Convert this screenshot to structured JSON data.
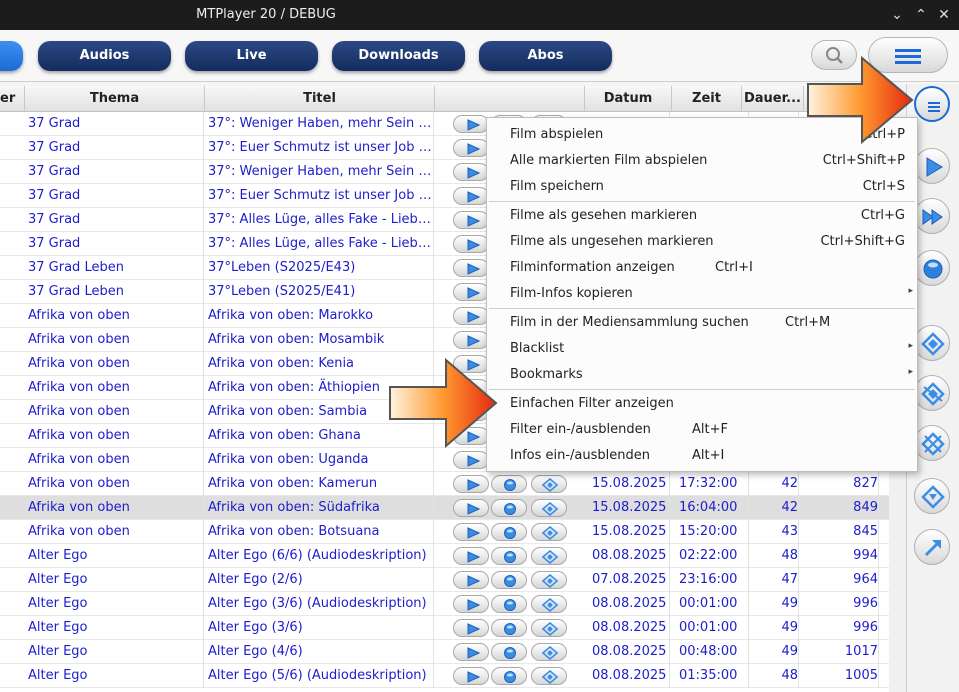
{
  "window": {
    "title": "MTPlayer 20 / DEBUG"
  },
  "toolbar": {
    "tabs": [
      "Audios",
      "Live",
      "Downloads",
      "Abos"
    ]
  },
  "table": {
    "headers": {
      "partial": "er",
      "thema": "Thema",
      "titel": "Titel",
      "datum": "Datum",
      "zeit": "Zeit",
      "dauer": "Dauer..."
    },
    "rows": [
      {
        "thema": "37 Grad",
        "titel": "37°: Weniger Haben, mehr Sein (S...",
        "datum": "",
        "zeit": "",
        "dauer": "",
        "size": ""
      },
      {
        "thema": "37 Grad",
        "titel": "37°: Euer Schmutz ist unser Job (S...",
        "datum": "",
        "zeit": "",
        "dauer": "",
        "size": ""
      },
      {
        "thema": "37 Grad",
        "titel": "37°: Weniger Haben, mehr Sein (S...",
        "datum": "",
        "zeit": "",
        "dauer": "",
        "size": ""
      },
      {
        "thema": "37 Grad",
        "titel": "37°: Euer Schmutz ist unser Job (S...",
        "datum": "",
        "zeit": "",
        "dauer": "",
        "size": ""
      },
      {
        "thema": "37 Grad",
        "titel": "37°: Alles Lüge, alles Fake - Liebes...",
        "datum": "",
        "zeit": "",
        "dauer": "",
        "size": ""
      },
      {
        "thema": "37 Grad",
        "titel": "37°: Alles Lüge, alles Fake - Liebes...",
        "datum": "",
        "zeit": "",
        "dauer": "",
        "size": ""
      },
      {
        "thema": "37 Grad Leben",
        "titel": "37°Leben (S2025/E43)",
        "datum": "",
        "zeit": "",
        "dauer": "",
        "size": ""
      },
      {
        "thema": "37 Grad Leben",
        "titel": "37°Leben (S2025/E41)",
        "datum": "",
        "zeit": "",
        "dauer": "",
        "size": ""
      },
      {
        "thema": "Afrika von oben",
        "titel": "Afrika von oben: Marokko",
        "datum": "",
        "zeit": "",
        "dauer": "",
        "size": ""
      },
      {
        "thema": "Afrika von oben",
        "titel": "Afrika von oben: Mosambik",
        "datum": "",
        "zeit": "",
        "dauer": "",
        "size": ""
      },
      {
        "thema": "Afrika von oben",
        "titel": "Afrika von oben: Kenia",
        "datum": "",
        "zeit": "",
        "dauer": "",
        "size": ""
      },
      {
        "thema": "Afrika von oben",
        "titel": "Afrika von oben: Äthiopien",
        "datum": "",
        "zeit": "",
        "dauer": "",
        "size": ""
      },
      {
        "thema": "Afrika von oben",
        "titel": "Afrika von oben: Sambia",
        "datum": "",
        "zeit": "",
        "dauer": "",
        "size": ""
      },
      {
        "thema": "Afrika von oben",
        "titel": "Afrika von oben: Ghana",
        "datum": "",
        "zeit": "",
        "dauer": "",
        "size": ""
      },
      {
        "thema": "Afrika von oben",
        "titel": "Afrika von oben: Uganda",
        "datum": "",
        "zeit": "",
        "dauer": "",
        "size": ""
      },
      {
        "thema": "Afrika von oben",
        "titel": "Afrika von oben: Kamerun",
        "datum": "15.08.2025",
        "zeit": "17:32:00",
        "dauer": "42",
        "size": "827"
      },
      {
        "thema": "Afrika von oben",
        "titel": "Afrika von oben: Südafrika",
        "datum": "15.08.2025",
        "zeit": "16:04:00",
        "dauer": "42",
        "size": "849"
      },
      {
        "thema": "Afrika von oben",
        "titel": "Afrika von oben: Botsuana",
        "datum": "15.08.2025",
        "zeit": "15:20:00",
        "dauer": "43",
        "size": "845"
      },
      {
        "thema": "Alter Ego",
        "titel": "Alter Ego (6/6) (Audiodeskription)",
        "datum": "08.08.2025",
        "zeit": "02:22:00",
        "dauer": "48",
        "size": "994"
      },
      {
        "thema": "Alter Ego",
        "titel": "Alter Ego (2/6)",
        "datum": "07.08.2025",
        "zeit": "23:16:00",
        "dauer": "47",
        "size": "964"
      },
      {
        "thema": "Alter Ego",
        "titel": "Alter Ego (3/6) (Audiodeskription)",
        "datum": "08.08.2025",
        "zeit": "00:01:00",
        "dauer": "49",
        "size": "996"
      },
      {
        "thema": "Alter Ego",
        "titel": "Alter Ego (3/6)",
        "datum": "08.08.2025",
        "zeit": "00:01:00",
        "dauer": "49",
        "size": "996"
      },
      {
        "thema": "Alter Ego",
        "titel": "Alter Ego (4/6)",
        "datum": "08.08.2025",
        "zeit": "00:48:00",
        "dauer": "49",
        "size": "1017"
      },
      {
        "thema": "Alter Ego",
        "titel": "Alter Ego (5/6) (Audiodeskription)",
        "datum": "08.08.2025",
        "zeit": "01:35:00",
        "dauer": "48",
        "size": "1005"
      }
    ],
    "selected_row": 16
  },
  "context_menu": {
    "items": [
      {
        "label": "Film abspielen",
        "shortcut": "Ctrl+P",
        "submenu": false
      },
      {
        "label": "Alle markierten Film abspielen",
        "shortcut": "Ctrl+Shift+P",
        "submenu": false
      },
      {
        "label": "Film speichern",
        "shortcut": "Ctrl+S",
        "submenu": false
      },
      {
        "label": "Filme als gesehen markieren",
        "shortcut": "Ctrl+G",
        "submenu": false
      },
      {
        "label": "Filme als ungesehen markieren",
        "shortcut": "Ctrl+Shift+G",
        "submenu": false
      },
      {
        "label": "Filminformation anzeigen",
        "shortcut": "Ctrl+I",
        "submenu": false
      },
      {
        "label": "Film-Infos kopieren",
        "shortcut": "",
        "submenu": true
      },
      {
        "label": "Film in der Mediensammlung suchen",
        "shortcut": "Ctrl+M",
        "submenu": false
      },
      {
        "label": "Blacklist",
        "shortcut": "",
        "submenu": true
      },
      {
        "label": "Bookmarks",
        "shortcut": "",
        "submenu": true
      },
      {
        "label": "Einfachen Filter anzeigen",
        "shortcut": "",
        "submenu": false
      },
      {
        "label": "Filter ein-/ausblenden",
        "shortcut": "Alt+F",
        "submenu": false
      },
      {
        "label": "Infos ein-/ausblenden",
        "shortcut": "Alt+I",
        "submenu": false
      }
    ]
  },
  "sidebar": {
    "buttons": [
      "menu-icon",
      "play-icon",
      "fast-forward-icon",
      "record-icon",
      "diamond-icon",
      "diamond-strike-icon",
      "diamond-cross-icon",
      "download-diamond-icon",
      "arrow-icon"
    ]
  },
  "colors": {
    "accent": "#1d6ad6",
    "tab_dark": "#1e3a74",
    "link_text": "#1d1dcc",
    "arrow_orange": "#ff7a1a"
  }
}
